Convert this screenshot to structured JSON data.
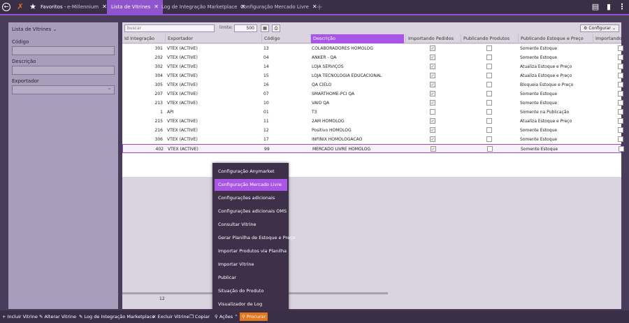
{
  "topbar": {
    "favorites_label": "Favoritos -",
    "tabs": [
      {
        "label": "e-Millennium"
      },
      {
        "label": "Lista de Vitrines"
      },
      {
        "label": "Log de Integração Marketplace"
      },
      {
        "label": "Configuração Mercado Livre"
      }
    ]
  },
  "left": {
    "title": "Lista de Vitrines",
    "codigo_label": "Código",
    "descricao_label": "Descrição",
    "exportador_label": "Exportador"
  },
  "toolbar": {
    "search_placeholder": "buscar",
    "limite_label": "limite:",
    "limite_value": "500",
    "configurar_label": "Configurar"
  },
  "columns": [
    "Id Integração",
    "Exportador",
    "Código",
    "Descrição",
    "Importando Pedidos",
    "Publicando Produtos",
    "Publicando Estoque e Preço",
    "Importando"
  ],
  "rows": [
    {
      "id": "301",
      "exp": "VTEX (ACTIVE)",
      "cod": "13",
      "desc": "COLABORADORES HOMOLOG",
      "imp": true,
      "pub": false,
      "est": "Somente Estoque"
    },
    {
      "id": "202",
      "exp": "VTEX (ACTIVE)",
      "cod": "04",
      "desc": "ANKER - QA",
      "imp": true,
      "pub": false,
      "est": "Somente Estoque"
    },
    {
      "id": "302",
      "exp": "VTEX (ACTIVE)",
      "cod": "14",
      "desc": "LOJA SERVIÇOS",
      "imp": true,
      "pub": false,
      "est": "Atualiza Estoque e Preço"
    },
    {
      "id": "304",
      "exp": "VTEX (ACTIVE)",
      "cod": "15",
      "desc": "LOJA TECNOLOGIA EDUCACIONAL",
      "imp": true,
      "pub": false,
      "est": "Atualiza Estoque e Preço"
    },
    {
      "id": "305",
      "exp": "VTEX (ACTIVE)",
      "cod": "16",
      "desc": "QA CIELO",
      "imp": true,
      "pub": false,
      "est": "Bloqueia Estoque e Preço"
    },
    {
      "id": "207",
      "exp": "VTEX (ACTIVE)",
      "cod": "07",
      "desc": "SMARTHOME-PCI QA",
      "imp": true,
      "pub": false,
      "est": "Somente Estoque"
    },
    {
      "id": "213",
      "exp": "VTEX (ACTIVE)",
      "cod": "10",
      "desc": "VAIO QA",
      "imp": true,
      "pub": false,
      "est": "Somente Estoque"
    },
    {
      "id": "1",
      "exp": "API",
      "cod": "01",
      "desc": "T3",
      "imp": false,
      "pub": false,
      "est": "Somente na Publicação"
    },
    {
      "id": "215",
      "exp": "VTEX (ACTIVE)",
      "cod": "11",
      "desc": "2AM HOMOLOG",
      "imp": true,
      "pub": false,
      "est": "Atualiza Estoque e Preço"
    },
    {
      "id": "216",
      "exp": "VTEX (ACTIVE)",
      "cod": "12",
      "desc": "Positivo HOMOLOG",
      "imp": true,
      "pub": false,
      "est": "Somente Estoque"
    },
    {
      "id": "306",
      "exp": "VTEX (ACTIVE)",
      "cod": "17",
      "desc": "INFINIX HOMOLOGACAO",
      "imp": true,
      "pub": false,
      "est": "Somente Estoque"
    },
    {
      "id": "402",
      "exp": "VTEX (ACTIVE)",
      "cod": "99",
      "desc": "MERCADO LIVRE HOMOLOG",
      "imp": true,
      "pub": false,
      "est": "Somente Estoque"
    }
  ],
  "row_count": "12",
  "menu": [
    "Configuração Anymarket",
    "Configuração Mercado Livre",
    "Configurações adicionais",
    "Configurações adicionais OMS",
    "Consultar Vitrine",
    "Gerar Planilha de Estoque e Preço",
    "Importar Produtos via Planilha",
    "Importar Vitrine",
    "Publicar",
    "Situação do Produto",
    "Visualizador de Log"
  ],
  "bottombar": {
    "incluir": "Incluir Vitrine",
    "alterar": "Alterar Vitrine",
    "log": "Log de Integração Marketplace",
    "excluir": "Excluir Vitrine",
    "copiar": "Copiar",
    "acoes": "Ações",
    "procurar": "Procurar"
  },
  "colors": {
    "accent": "#8f55cc",
    "highlight": "#a855e8",
    "orange": "#e4761b",
    "dark": "#3b2f48"
  }
}
